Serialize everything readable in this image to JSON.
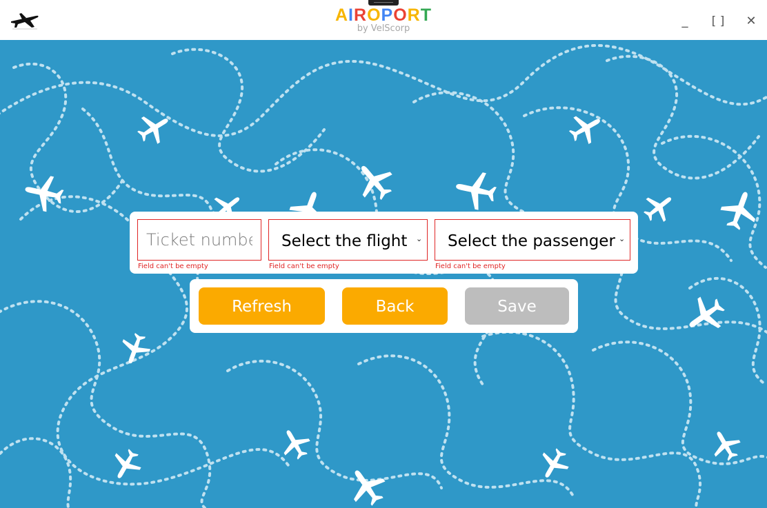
{
  "app": {
    "title_letters": [
      {
        "ch": "A",
        "color": "#f7b500"
      },
      {
        "ch": "I",
        "color": "#4285f4"
      },
      {
        "ch": "R",
        "color": "#ea4335"
      },
      {
        "ch": "O",
        "color": "#f7b500"
      },
      {
        "ch": "P",
        "color": "#4285f4"
      },
      {
        "ch": "O",
        "color": "#ea4335"
      },
      {
        "ch": "R",
        "color": "#f7b500"
      },
      {
        "ch": "T",
        "color": "#34a853"
      }
    ],
    "subtitle": "by VelScorp",
    "icon": "airplane-icon"
  },
  "window_controls": {
    "minimize": "_",
    "maximize": "[ ]",
    "close": "✕"
  },
  "form": {
    "ticket_placeholder": "Ticket number",
    "ticket_value": "",
    "flight_select": "Select the flight",
    "passenger_select": "Select the passenger",
    "error_ticket": "Field can't be empty",
    "error_flight": "Field can't be empty",
    "error_passenger": "Field can't be empty"
  },
  "buttons": {
    "refresh": "Refresh",
    "back": "Back",
    "save": "Save"
  },
  "colors": {
    "background": "#2f98c8",
    "accent": "#fbaa00",
    "disabled": "#bdbdbd",
    "error": "#e02424"
  }
}
